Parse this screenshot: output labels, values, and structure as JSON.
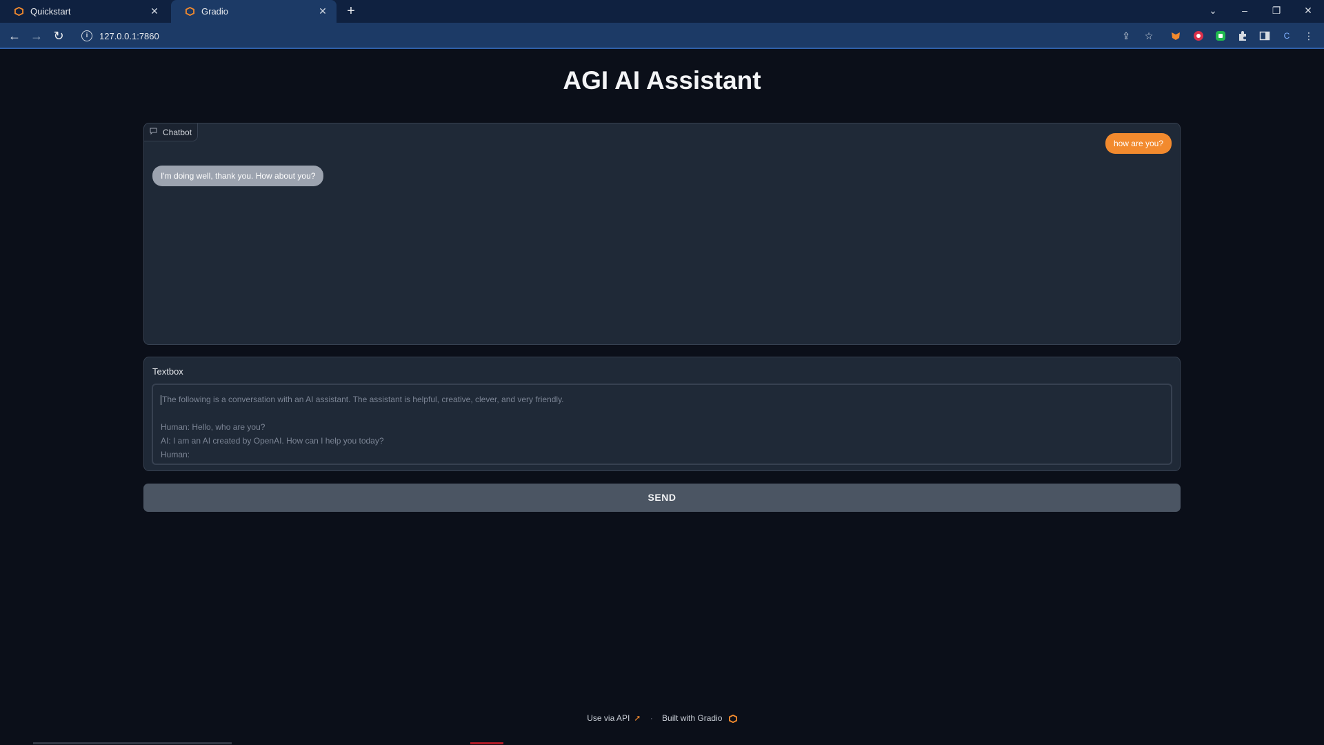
{
  "browser": {
    "tabs": [
      {
        "label": "Quickstart",
        "active": false
      },
      {
        "label": "Gradio",
        "active": true
      }
    ],
    "url": "127.0.0.1:7860"
  },
  "app": {
    "title": "AGI AI Assistant",
    "chatbot": {
      "label": "Chatbot",
      "messages": [
        {
          "role": "user",
          "text": "how are you?"
        },
        {
          "role": "bot",
          "text": "I'm doing well, thank you. How about you?"
        }
      ]
    },
    "textbox": {
      "label": "Textbox",
      "value": "The following is a conversation with an AI assistant. The assistant is helpful, creative, clever, and very friendly.\n\nHuman: Hello, who are you?\nAI: I am an AI created by OpenAI. How can I help you today?\nHuman:"
    },
    "send_label": "SEND"
  },
  "footer": {
    "api_label": "Use via API",
    "separator": "·",
    "built_label": "Built with Gradio"
  },
  "colors": {
    "background": "#0b0f19",
    "panel": "#1f2937",
    "user_bubble": "#f28a2e",
    "bot_bubble": "#9ca3af",
    "button": "#4b5563"
  }
}
